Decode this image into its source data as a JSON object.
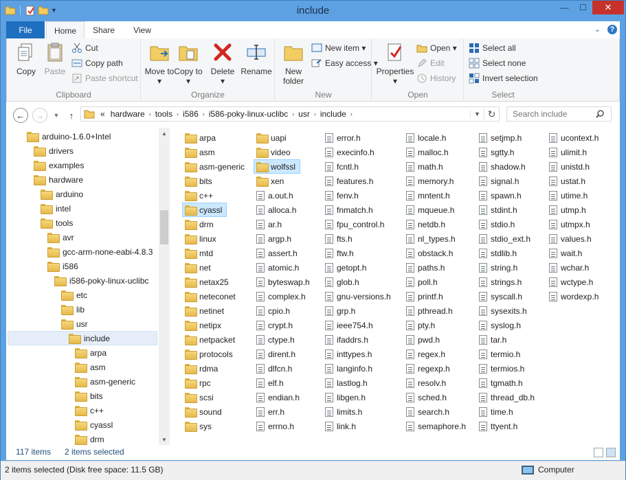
{
  "window": {
    "title": "include"
  },
  "tabs": [
    {
      "label": "File"
    },
    {
      "label": "Home"
    },
    {
      "label": "Share"
    },
    {
      "label": "View"
    }
  ],
  "ribbon": {
    "clipboard": {
      "label": "Clipboard",
      "copy": "Copy",
      "paste": "Paste",
      "cut": "Cut",
      "copy_path": "Copy path",
      "paste_shortcut": "Paste shortcut"
    },
    "organize": {
      "label": "Organize",
      "move_to": "Move to ▾",
      "copy_to": "Copy to ▾",
      "delete": "Delete ▾",
      "rename": "Rename"
    },
    "new": {
      "label": "New",
      "new_folder": "New folder",
      "new_item": "New item ▾",
      "easy_access": "Easy access ▾"
    },
    "open": {
      "label": "Open",
      "properties": "Properties ▾",
      "open": "Open ▾",
      "edit": "Edit",
      "history": "History"
    },
    "select": {
      "label": "Select",
      "select_all": "Select all",
      "select_none": "Select none",
      "invert": "Invert selection"
    }
  },
  "address": {
    "crumbs": [
      "«",
      "hardware",
      "tools",
      "i586",
      "i586-poky-linux-uclibc",
      "usr",
      "include"
    ],
    "search_placeholder": "Search include"
  },
  "tree": [
    {
      "label": "arduino-1.6.0+Intel",
      "indent": 0
    },
    {
      "label": "drivers",
      "indent": 1
    },
    {
      "label": "examples",
      "indent": 1
    },
    {
      "label": "hardware",
      "indent": 1
    },
    {
      "label": "arduino",
      "indent": 2
    },
    {
      "label": "intel",
      "indent": 2
    },
    {
      "label": "tools",
      "indent": 2
    },
    {
      "label": "avr",
      "indent": 3
    },
    {
      "label": "gcc-arm-none-eabi-4.8.3",
      "indent": 3
    },
    {
      "label": "i586",
      "indent": 3
    },
    {
      "label": "i586-poky-linux-uclibc",
      "indent": 4
    },
    {
      "label": "etc",
      "indent": 5
    },
    {
      "label": "lib",
      "indent": 5
    },
    {
      "label": "usr",
      "indent": 5
    },
    {
      "label": "include",
      "indent": 6,
      "selected": true
    },
    {
      "label": "arpa",
      "indent": 7
    },
    {
      "label": "asm",
      "indent": 7
    },
    {
      "label": "asm-generic",
      "indent": 7
    },
    {
      "label": "bits",
      "indent": 7
    },
    {
      "label": "c++",
      "indent": 7
    },
    {
      "label": "cyassl",
      "indent": 7
    },
    {
      "label": "drm",
      "indent": 7
    }
  ],
  "columns": [
    {
      "type": "folder",
      "items": [
        "arpa",
        "asm",
        "asm-generic",
        "bits",
        "c++",
        "cyassl",
        "drm",
        "linux",
        "mtd",
        "net",
        "netax25",
        "neteconet",
        "netinet",
        "netipx",
        "netpacket",
        "protocols",
        "rdma",
        "rpc",
        "scsi",
        "sound",
        "sys"
      ]
    },
    {
      "type": "mixed",
      "items": [
        "uapi",
        "video",
        "wolfssl",
        "xen",
        "a.out.h",
        "alloca.h",
        "ar.h",
        "argp.h",
        "assert.h",
        "atomic.h",
        "byteswap.h",
        "complex.h",
        "cpio.h",
        "crypt.h",
        "ctype.h",
        "dirent.h",
        "dlfcn.h",
        "elf.h",
        "endian.h",
        "err.h",
        "errno.h"
      ]
    },
    {
      "type": "file",
      "items": [
        "error.h",
        "execinfo.h",
        "fcntl.h",
        "features.h",
        "fenv.h",
        "fnmatch.h",
        "fpu_control.h",
        "fts.h",
        "ftw.h",
        "getopt.h",
        "glob.h",
        "gnu-versions.h",
        "grp.h",
        "ieee754.h",
        "ifaddrs.h",
        "inttypes.h",
        "langinfo.h",
        "lastlog.h",
        "libgen.h",
        "limits.h",
        "link.h"
      ]
    },
    {
      "type": "file",
      "items": [
        "locale.h",
        "malloc.h",
        "math.h",
        "memory.h",
        "mntent.h",
        "mqueue.h",
        "netdb.h",
        "nl_types.h",
        "obstack.h",
        "paths.h",
        "poll.h",
        "printf.h",
        "pthread.h",
        "pty.h",
        "pwd.h",
        "regex.h",
        "regexp.h",
        "resolv.h",
        "sched.h",
        "search.h",
        "semaphore.h"
      ]
    },
    {
      "type": "file",
      "items": [
        "setjmp.h",
        "sgtty.h",
        "shadow.h",
        "signal.h",
        "spawn.h",
        "stdint.h",
        "stdio.h",
        "stdio_ext.h",
        "stdlib.h",
        "string.h",
        "strings.h",
        "syscall.h",
        "sysexits.h",
        "syslog.h",
        "tar.h",
        "termio.h",
        "termios.h",
        "tgmath.h",
        "thread_db.h",
        "time.h",
        "ttyent.h"
      ]
    },
    {
      "type": "file",
      "items": [
        "ucontext.h",
        "ulimit.h",
        "unistd.h",
        "ustat.h",
        "utime.h",
        "utmp.h",
        "utmpx.h",
        "values.h",
        "wait.h",
        "wchar.h",
        "wctype.h",
        "wordexp.h"
      ]
    }
  ],
  "selected_items": [
    "cyassl",
    "wolfssl"
  ],
  "status": {
    "count": "117 items",
    "selected": "2 items selected"
  },
  "bottom": {
    "info": "2 items selected (Disk free space: 11.5 GB)",
    "location": "Computer"
  }
}
